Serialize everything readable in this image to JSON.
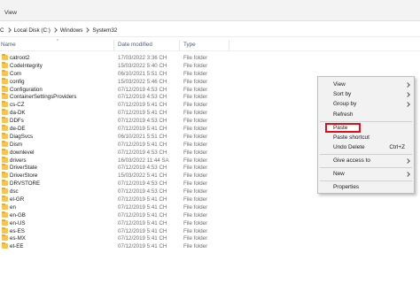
{
  "ribbon": {
    "tab_label": "View"
  },
  "address": {
    "crumbs": [
      "C",
      "Local Disk (C:)",
      "Windows",
      "System32"
    ]
  },
  "columns": {
    "name": "Name",
    "date": "Date modified",
    "type": "Type"
  },
  "rows": [
    {
      "name": "catroot2",
      "date": "17/03/2022 3:36 CH",
      "type": "File folder"
    },
    {
      "name": "CodeIntegrity",
      "date": "15/03/2022 5:40 CH",
      "type": "File folder"
    },
    {
      "name": "Com",
      "date": "06/10/2021 5:51 CH",
      "type": "File folder"
    },
    {
      "name": "config",
      "date": "15/03/2022 5:46 CH",
      "type": "File folder"
    },
    {
      "name": "Configuration",
      "date": "07/12/2019 4:53 CH",
      "type": "File folder"
    },
    {
      "name": "ContainerSettingsProviders",
      "date": "07/12/2019 4:53 CH",
      "type": "File folder"
    },
    {
      "name": "cs-CZ",
      "date": "07/12/2019 5:41 CH",
      "type": "File folder"
    },
    {
      "name": "da-DK",
      "date": "07/12/2019 5:41 CH",
      "type": "File folder"
    },
    {
      "name": "DDFs",
      "date": "07/12/2019 4:53 CH",
      "type": "File folder"
    },
    {
      "name": "de-DE",
      "date": "07/12/2019 5:41 CH",
      "type": "File folder"
    },
    {
      "name": "DiagSvcs",
      "date": "06/10/2021 5:51 CH",
      "type": "File folder"
    },
    {
      "name": "Dism",
      "date": "07/12/2019 5:41 CH",
      "type": "File folder"
    },
    {
      "name": "downlevel",
      "date": "07/12/2019 4:53 CH",
      "type": "File folder"
    },
    {
      "name": "drivers",
      "date": "16/03/2022 11:44 SA",
      "type": "File folder"
    },
    {
      "name": "DriverState",
      "date": "07/12/2019 4:53 CH",
      "type": "File folder"
    },
    {
      "name": "DriverStore",
      "date": "15/03/2022 5:41 CH",
      "type": "File folder"
    },
    {
      "name": "DRVSTORE",
      "date": "07/12/2019 4:53 CH",
      "type": "File folder"
    },
    {
      "name": "dsc",
      "date": "07/12/2019 4:53 CH",
      "type": "File folder"
    },
    {
      "name": "el-GR",
      "date": "07/12/2019 5:41 CH",
      "type": "File folder"
    },
    {
      "name": "en",
      "date": "07/12/2019 5:41 CH",
      "type": "File folder"
    },
    {
      "name": "en-GB",
      "date": "07/12/2019 5:41 CH",
      "type": "File folder"
    },
    {
      "name": "en-US",
      "date": "07/12/2019 5:41 CH",
      "type": "File folder"
    },
    {
      "name": "es-ES",
      "date": "07/12/2019 5:41 CH",
      "type": "File folder"
    },
    {
      "name": "es-MX",
      "date": "07/12/2019 5:41 CH",
      "type": "File folder"
    },
    {
      "name": "et-EE",
      "date": "07/12/2019 5:41 CH",
      "type": "File folder"
    }
  ],
  "context_menu": {
    "view": "View",
    "sort_by": "Sort by",
    "group_by": "Group by",
    "refresh": "Refresh",
    "paste": "Paste",
    "paste_shortcut": "Paste shortcut",
    "undo_delete": "Undo Delete",
    "undo_shortcut_key": "Ctrl+Z",
    "give_access_to": "Give access to",
    "new": "New",
    "properties": "Properties"
  },
  "colors": {
    "highlight_box": "#e0101a",
    "folder": "#f7c451"
  }
}
